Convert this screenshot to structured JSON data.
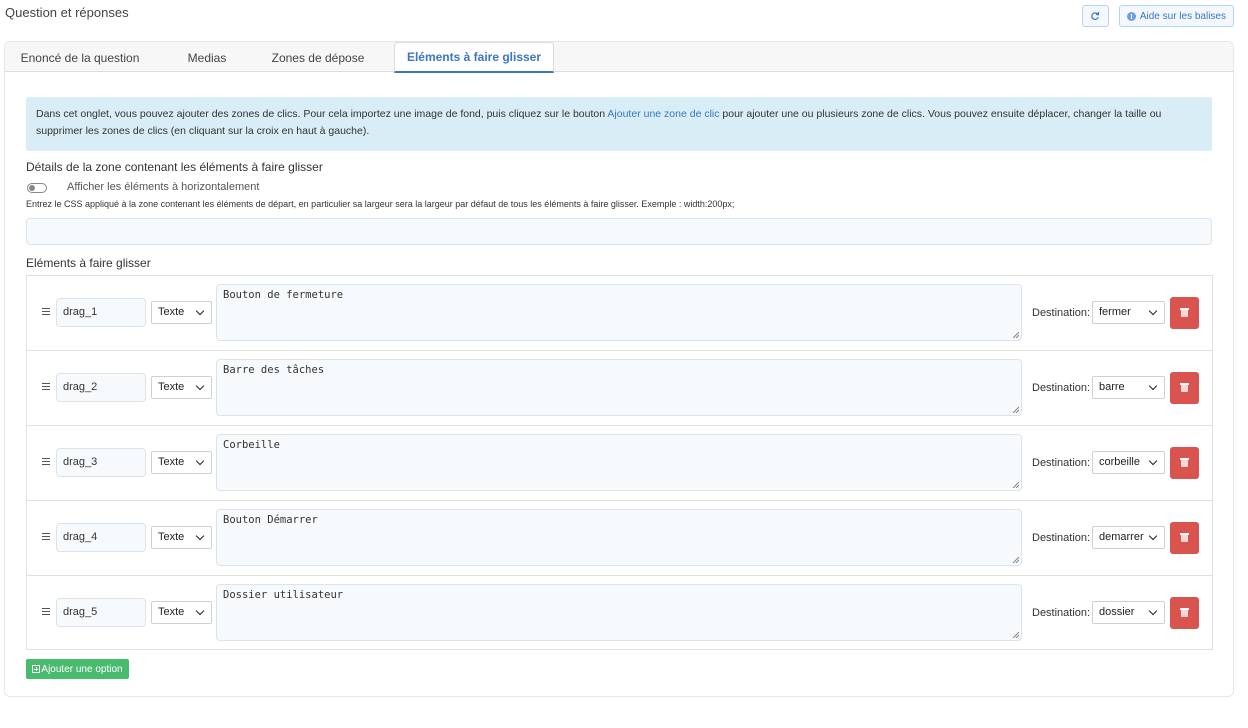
{
  "page": {
    "title": "Question et réponses"
  },
  "top_actions": {
    "refresh_icon": "refresh-icon",
    "help_label": "Aide sur les balises",
    "help_icon": "info-icon"
  },
  "tabs": [
    {
      "label": "Enoncé de la question",
      "active": false
    },
    {
      "label": "Medias",
      "active": false
    },
    {
      "label": "Zones de dépose",
      "active": false
    },
    {
      "label": "Eléments à faire glisser",
      "active": true
    }
  ],
  "info": {
    "text_before": "Dans cet onglet, vous pouvez ajouter des zones de clics. Pour cela importez une image de fond, puis cliquez sur le bouton ",
    "link": "Ajouter une zone de clic",
    "text_after": " pour ajouter une ou plusieurs zone de clics. Vous pouvez ensuite déplacer, changer la taille ou supprimer les zones de clics (en cliquant sur la croix en haut à gauche)."
  },
  "zone_details": {
    "title": "Détails de la zone contenant les éléments à faire glisser",
    "toggle_label": "Afficher les éléments à horizontalement",
    "toggle_on": false,
    "css_hint": "Entrez le CSS appliqué à la zone contenant les éléments de départ, en particulier sa largeur sera la largeur par défaut de tous les éléments à faire glisser. Exemple : width:200px;",
    "css_value": ""
  },
  "drag_items_title": "Eléments à faire glisser",
  "destination_label": "Destination:",
  "drag_items": [
    {
      "id": "drag_1",
      "type": "Texte",
      "text": "Bouton de fermeture",
      "destination": "fermer"
    },
    {
      "id": "drag_2",
      "type": "Texte",
      "text": "Barre des tâches",
      "destination": "barre"
    },
    {
      "id": "drag_3",
      "type": "Texte",
      "text": "Corbeille",
      "destination": "corbeille"
    },
    {
      "id": "drag_4",
      "type": "Texte",
      "text": "Bouton Démarrer",
      "destination": "demarrer"
    },
    {
      "id": "drag_5",
      "type": "Texte",
      "text": "Dossier utilisateur",
      "destination": "dossier"
    }
  ],
  "add_option_label": "Ajouter une option",
  "colors": {
    "accent": "#3a76c4",
    "info_bg": "#d8edf5",
    "delete": "#d9534f",
    "add": "#48bb6e"
  }
}
